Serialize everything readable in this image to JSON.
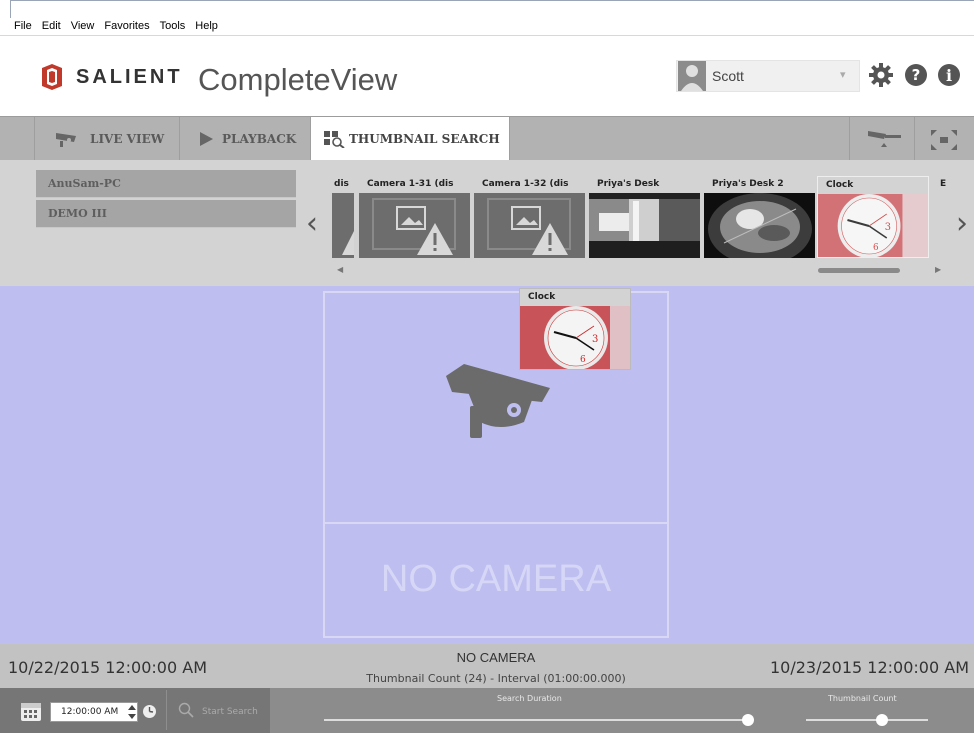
{
  "menu": [
    "File",
    "Edit",
    "View",
    "Favorites",
    "Tools",
    "Help"
  ],
  "header": {
    "brand": "SALIENT",
    "product": "CompleteView",
    "user": "Scott",
    "icons": [
      "gear-icon",
      "help-icon",
      "info-icon"
    ]
  },
  "tabs": [
    {
      "label": "LIVE VIEW",
      "icon": "camera-icon",
      "active": false
    },
    {
      "label": "PLAYBACK",
      "icon": "play-icon",
      "active": false
    },
    {
      "label": "THUMBNAIL SEARCH",
      "icon": "thumbnail-search-icon",
      "active": true
    }
  ],
  "servers": [
    "AnuSam-PC",
    "DEMO III"
  ],
  "thumbnails": [
    {
      "label": "dis",
      "kind": "warning"
    },
    {
      "label": "Camera 1-31 (dis",
      "kind": "warning"
    },
    {
      "label": "Camera 1-32 (dis",
      "kind": "warning"
    },
    {
      "label": "Priya's Desk",
      "kind": "office"
    },
    {
      "label": "Priya's Desk 2",
      "kind": "fisheye"
    },
    {
      "label": "Clock",
      "kind": "clock"
    },
    {
      "label": "E",
      "kind": "partial"
    }
  ],
  "drag_thumbnail": {
    "label": "Clock"
  },
  "main": {
    "no_camera": "NO CAMERA"
  },
  "footer": {
    "start_date": "10/22/2015 12:00:00 AM",
    "end_date": "10/23/2015 12:00:00 AM",
    "camera": "NO CAMERA",
    "info": "Thumbnail Count (24) - Interval (01:00:00.000)"
  },
  "controls": {
    "time": "12:00:00 AM",
    "start_search": "Start Search",
    "search_duration_label": "Search Duration",
    "search_duration_level": 1.0,
    "thumbnail_count_label": "Thumbnail Count",
    "thumbnail_count_level": 0.6
  }
}
